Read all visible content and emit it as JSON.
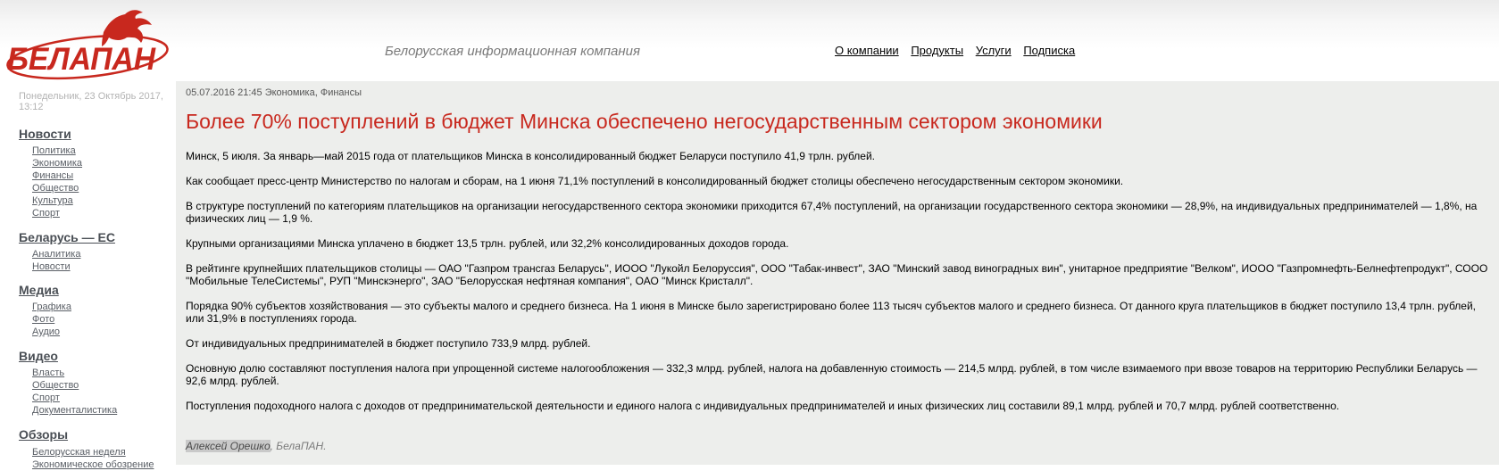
{
  "header": {
    "logo_text": "БЕЛАПАН",
    "slogan": "Белорусская информационная компания",
    "nav": [
      "О компании",
      "Продукты",
      "Услуги",
      "Подписка"
    ]
  },
  "sidebar": {
    "date": "Понедельник, 23 Октябрь 2017, 13:12",
    "sections": [
      {
        "title": "Новости",
        "items": [
          "Политика",
          "Экономика",
          "Финансы",
          "Общество",
          "Культура",
          "Спорт"
        ]
      },
      {
        "title": "Беларусь — ЕС",
        "items": [
          "Аналитика",
          "Новости"
        ]
      },
      {
        "title": "Медиа",
        "items": [
          "Графика",
          "Фото",
          "Аудио"
        ]
      },
      {
        "title": "Видео",
        "items": [
          "Власть",
          "Общество",
          "Спорт",
          "Документалистика"
        ]
      },
      {
        "title": "Обзоры",
        "items": [
          "Белорусская неделя",
          "Экономическое обозрение"
        ]
      }
    ]
  },
  "article": {
    "meta": "05.07.2016 21:45 Экономика, Финансы",
    "title": "Более 70% поступлений в бюджет Минска обеспечено негосударственным сектором экономики",
    "paragraphs": [
      "Минск, 5 июля. За январь—май 2015 года от плательщиков Минска в консолидированный бюджет Беларуси поступило 41,9 трлн. рублей.",
      "Как сообщает пресс-центр Министерство по налогам и сборам, на 1 июня 71,1% поступлений в консолидированный бюджет столицы обеспечено негосударственным сектором экономики.",
      "В структуре поступлений по категориям плательщиков на организации негосударственного сектора экономики приходится 67,4% поступлений, на организации государственного сектора экономики — 28,9%, на индивидуальных предпринимателей — 1,8%, на физических лиц — 1,9 %.",
      "Крупными организациями Минска уплачено в бюджет 13,5 трлн. рублей, или 32,2% консолидированных доходов города.",
      "В рейтинге крупнейших плательщиков столицы — ОАО \"Газпром трансгаз Беларусь\", ИООО \"Лукойл Белоруссия\", ООО \"Табак-инвест\", ЗАО \"Минский завод виноградных вин\", унитарное предприятие \"Велком\", ИООО \"Газпромнефть-Белнефтепродукт\", СООО \"Мобильные ТелеСистемы\", РУП \"Минскэнерго\", ЗАО \"Белорусская нефтяная компания\", ОАО \"Минск Кристалл\".",
      "Порядка 90% субъектов  хозяйствования — это субъекты малого и среднего бизнеса. На 1 июня в Минске было зарегистрировано более 113 тысяч субъектов малого и среднего бизнеса. От данного круга плательщиков в бюджет поступило 13,4 трлн. рублей, или 31,9% в поступлениях города.",
      "От индивидуальных предпринимателей в бюджет поступило 733,9 млрд. рублей.",
      "Основную долю составляют поступления налога при упрощенной системе налогообложения — 332,3 млрд. рублей, налога на добавленную стоимость — 214,5 млрд. рублей, в том числе взимаемого при ввозе товаров на территорию Республики Беларусь — 92,6 млрд. рублей.",
      "Поступления подоходного налога с доходов от предпринимательской деятельности и единого налога с индивидуальных предпринимателей и иных физических лиц составили 89,1 млрд. рублей и 70,7 млрд. рублей соответственно."
    ],
    "author": "Алексей Орешко",
    "agency": ", БелаПАН."
  },
  "colors": {
    "brand_red": "#c8281e",
    "content_bg": "#edeeec"
  }
}
